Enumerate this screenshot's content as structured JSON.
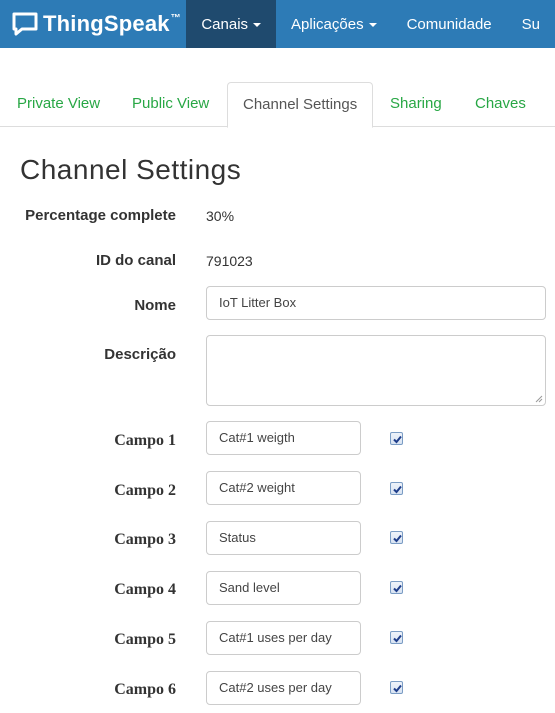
{
  "navbar": {
    "brand": "ThingSpeak",
    "brand_tm": "™",
    "items": [
      {
        "label": "Canais",
        "dropdown": true,
        "active": true
      },
      {
        "label": "Aplicações",
        "dropdown": true,
        "active": false
      },
      {
        "label": "Comunidade",
        "dropdown": false,
        "active": false
      },
      {
        "label": "Su",
        "dropdown": false,
        "active": false
      }
    ]
  },
  "tabs": [
    {
      "label": "Private View",
      "active": false
    },
    {
      "label": "Public View",
      "active": false
    },
    {
      "label": "Channel Settings",
      "active": true
    },
    {
      "label": "Sharing",
      "active": false
    },
    {
      "label": "Chaves",
      "active": false
    }
  ],
  "page_title": "Channel Settings",
  "form": {
    "percentage_label": "Percentage complete",
    "percentage_value": "30%",
    "channel_id_label": "ID do canal",
    "channel_id_value": "791023",
    "name_label": "Nome",
    "name_value": "IoT Litter Box",
    "description_label": "Descrição",
    "description_value": "",
    "fields": [
      {
        "label": "Campo 1",
        "value": "Cat#1 weigth",
        "checked": true
      },
      {
        "label": "Campo 2",
        "value": "Cat#2 weight",
        "checked": true
      },
      {
        "label": "Campo 3",
        "value": "Status",
        "checked": true
      },
      {
        "label": "Campo 4",
        "value": "Sand level",
        "checked": true
      },
      {
        "label": "Campo 5",
        "value": "Cat#1 uses per day",
        "checked": true
      },
      {
        "label": "Campo 6",
        "value": "Cat#2 uses per day",
        "checked": true
      }
    ]
  },
  "colors": {
    "navbar": "#2d7bb6",
    "navbar_active": "#1f4a6e",
    "tab_link": "#28a745"
  }
}
